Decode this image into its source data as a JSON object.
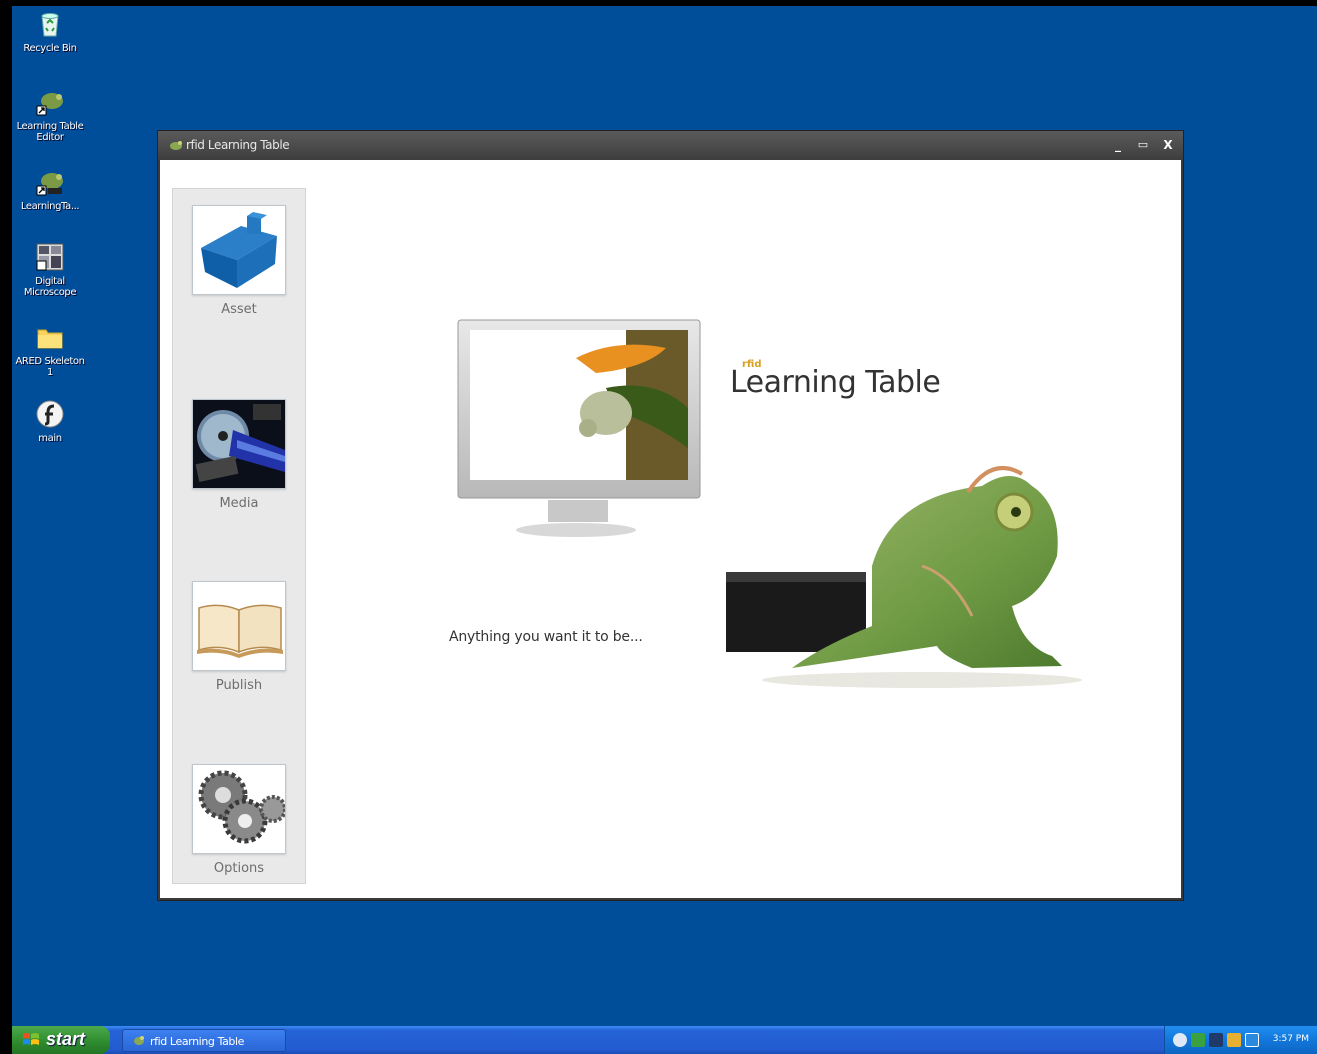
{
  "desktop": {
    "icons": [
      {
        "label": "Recycle Bin",
        "icon": "recycle-bin-icon"
      },
      {
        "label": "Learning Table Editor",
        "icon": "chameleon-shortcut-icon"
      },
      {
        "label": "LearningTa...",
        "icon": "chameleon-shortcut-icon"
      },
      {
        "label": "Digital Microscope",
        "icon": "microscope-app-icon"
      },
      {
        "label": "ARED Skeleton 1",
        "icon": "folder-icon"
      },
      {
        "label": "main",
        "icon": "flash-icon"
      }
    ]
  },
  "window": {
    "title": "rfid Learning Table",
    "minimize": "_",
    "maximize": "▭",
    "close": "X"
  },
  "sidebar": {
    "items": [
      {
        "label": "Asset",
        "icon": "house-asset-icon"
      },
      {
        "label": "Media",
        "icon": "media-devices-icon"
      },
      {
        "label": "Publish",
        "icon": "open-book-icon"
      },
      {
        "label": "Options",
        "icon": "gears-icon"
      }
    ]
  },
  "hero": {
    "brand_small": "rfid",
    "brand_title": "Learning Table",
    "tagline": "Anything you want it to be..."
  },
  "taskbar": {
    "start_label": "start",
    "task_label": "rfid Learning Table",
    "clock": "3:57 PM"
  },
  "colors": {
    "desktop": "#004d99",
    "taskbar": "#225bd0",
    "start_button": "#2d8a2d"
  }
}
